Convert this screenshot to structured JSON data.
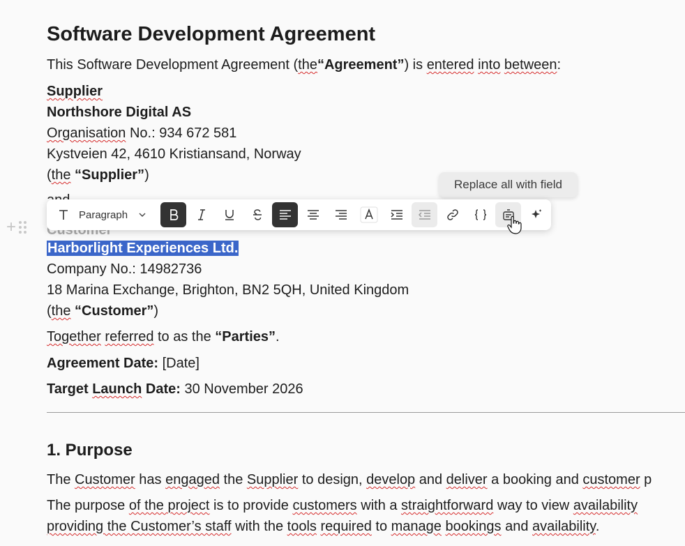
{
  "document": {
    "title": "Software Development Agreement",
    "intro": {
      "pre": "This Software Development Agreement (",
      "the": "the",
      "quote": "“Agreement”",
      "mid": ") is ",
      "entered": "entered",
      "sp": " ",
      "into": "into",
      "sp2": " ",
      "between": "between",
      "end": ":"
    },
    "supplier": {
      "heading": "Supplier",
      "name": "Northshore Digital AS",
      "org_label": "Organisation",
      "org_rest": " No.: 934 672 581",
      "address": "Kystveien 42, 4610 Kristiansand, Norway",
      "defined_open": "(",
      "defined_the": "the",
      "defined_quote": "“Supplier”",
      "defined_close": ")"
    },
    "and_text": "and",
    "customer": {
      "heading": "Customer",
      "name": "Harborlight Experiences Ltd.",
      "company_no": "Company No.: 14982736",
      "address": "18 Marina Exchange, Brighton, BN2 5QH, United Kingdom",
      "defined_open": "(",
      "defined_the": "the",
      "defined_quote": "“Customer”",
      "defined_close": ")"
    },
    "parties": {
      "together": "Together",
      "sp": " ",
      "referred": "referred",
      "mid": " to as the ",
      "quote": "“Parties”",
      "end": "."
    },
    "agreement_date": {
      "label": "Agreement Date:",
      "value": " [Date]"
    },
    "launch_date": {
      "label_a": "Target ",
      "label_b": "Launch",
      "label_c": " Date:",
      "value": " 30 November 2026"
    },
    "purpose_heading": "1. Purpose",
    "purpose_p1": {
      "a": "The ",
      "customer": "Customer",
      "b": " has ",
      "engaged": "engaged",
      "c": " the ",
      "supplier": "Supplier",
      "d": " to design, ",
      "develop": "develop",
      "e": " and ",
      "deliver": "deliver",
      "f": " a booking and ",
      "cust2": "customer",
      "g": " p"
    },
    "purpose_p2": {
      "a": "The purpose ",
      "of": "of the project",
      "b": " is to provide ",
      "customers": "customers",
      "c": " with a ",
      "straight": "straightforward",
      "d": " way to view ",
      "avail": "availability"
    },
    "purpose_p3": {
      "providing": "providing the Customer’s staff",
      "a": " with the ",
      "tools": "tools",
      "b": " ",
      "required": "required",
      "c": " to ",
      "manage": "manage",
      "d": " ",
      "bookings": "bookings",
      "e": " and ",
      "avail": "availability",
      "f": "."
    }
  },
  "toolbar": {
    "paragraph_label": "Paragraph",
    "tooltip": "Replace all with field"
  },
  "colors": {
    "selection": "#3b66c9",
    "active_button": "#333333",
    "spellcheck": "#d62b2b"
  }
}
